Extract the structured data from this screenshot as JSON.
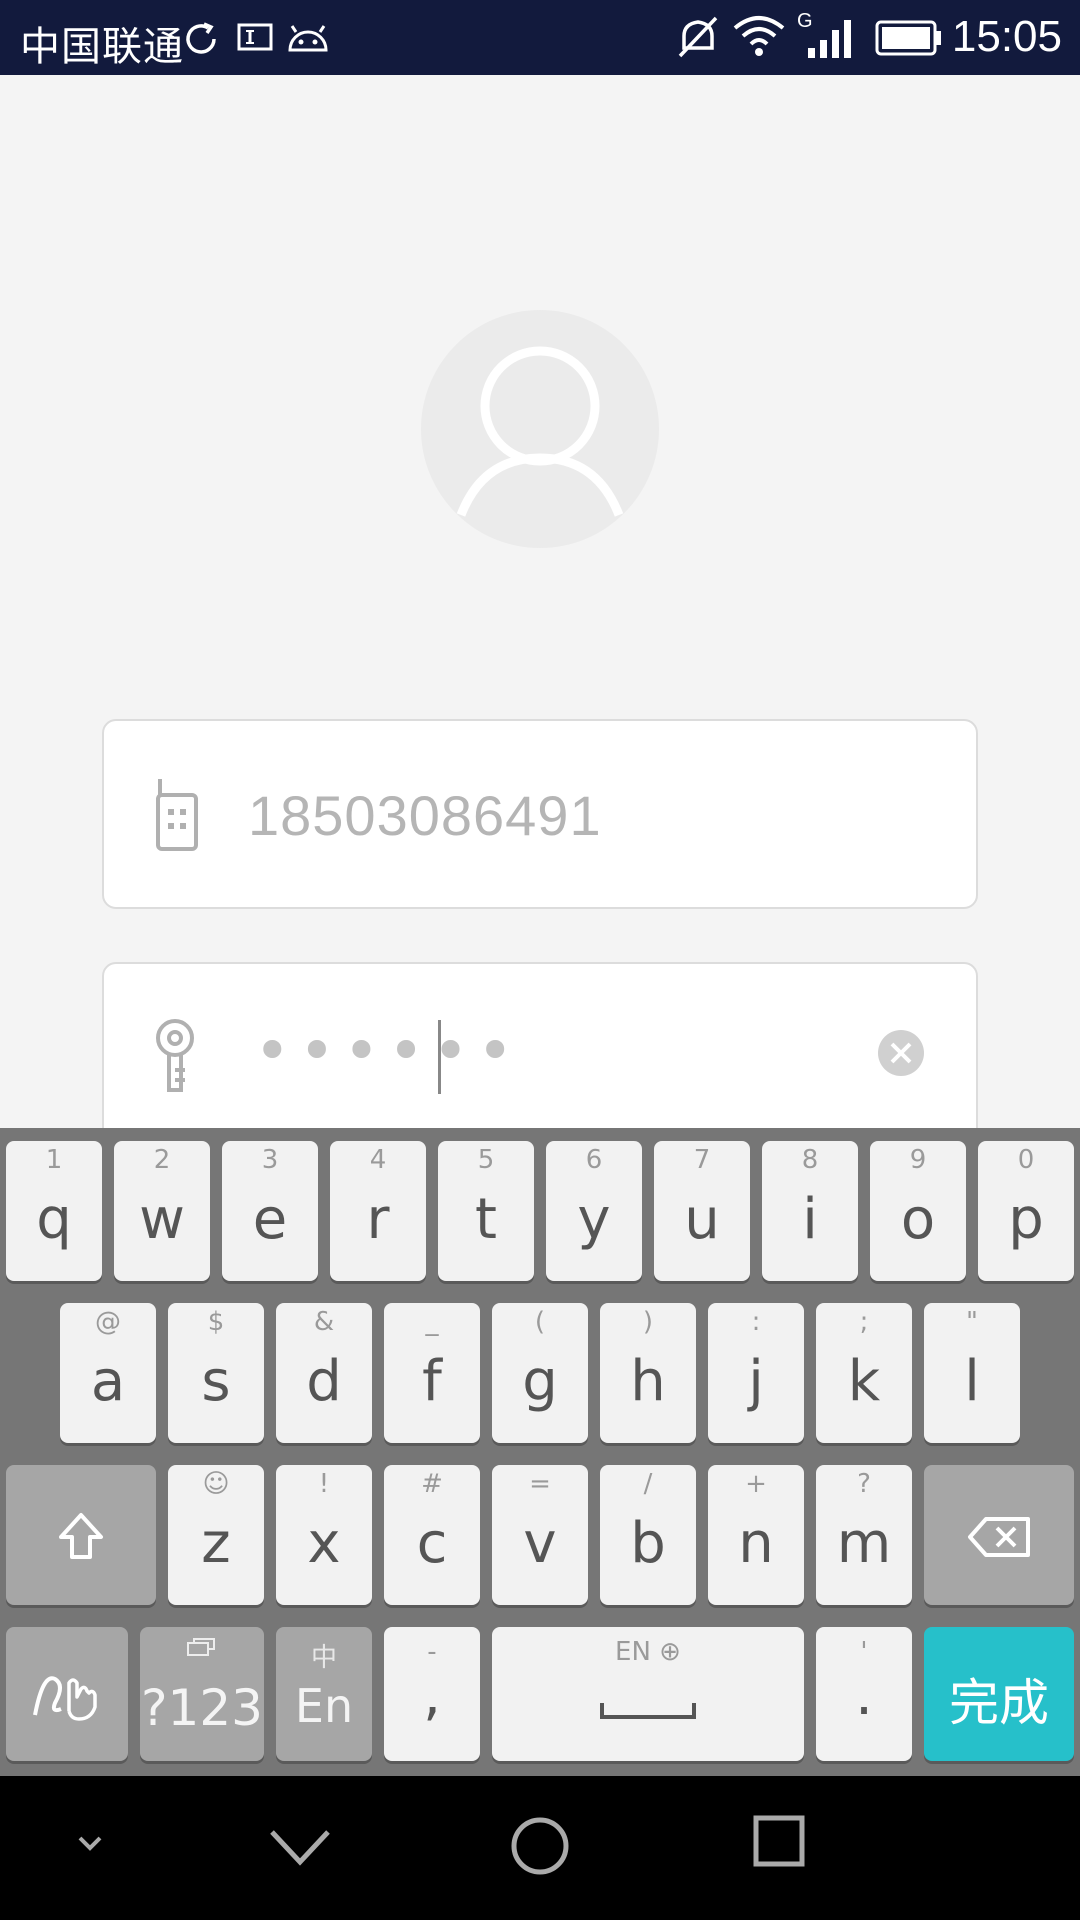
{
  "status_bar": {
    "carrier": "中国联通",
    "time": "15:05",
    "network_type": "G",
    "icons": [
      "sync-icon",
      "sim-card-icon",
      "android-icon",
      "mute-icon",
      "wifi-icon",
      "signal-icon",
      "battery-icon"
    ]
  },
  "login": {
    "phone_value": "18503086491",
    "password_masked": "••••••",
    "icons": [
      "avatar-icon",
      "phone-icon",
      "key-icon",
      "clear-icon"
    ]
  },
  "keyboard": {
    "row1": [
      {
        "hint": "1",
        "label": "q"
      },
      {
        "hint": "2",
        "label": "w"
      },
      {
        "hint": "3",
        "label": "e"
      },
      {
        "hint": "4",
        "label": "r"
      },
      {
        "hint": "5",
        "label": "t"
      },
      {
        "hint": "6",
        "label": "y"
      },
      {
        "hint": "7",
        "label": "u"
      },
      {
        "hint": "8",
        "label": "i"
      },
      {
        "hint": "9",
        "label": "o"
      },
      {
        "hint": "0",
        "label": "p"
      }
    ],
    "row2": [
      {
        "hint": "@",
        "label": "a"
      },
      {
        "hint": "$",
        "label": "s"
      },
      {
        "hint": "&",
        "label": "d"
      },
      {
        "hint": "_",
        "label": "f"
      },
      {
        "hint": "(",
        "label": "g"
      },
      {
        "hint": ")",
        "label": "h"
      },
      {
        "hint": ":",
        "label": "j"
      },
      {
        "hint": ";",
        "label": "k"
      },
      {
        "hint": "\"",
        "label": "l"
      }
    ],
    "row3": [
      {
        "hint": "☺",
        "label": "z"
      },
      {
        "hint": "!",
        "label": "x"
      },
      {
        "hint": "#",
        "label": "c"
      },
      {
        "hint": "=",
        "label": "v"
      },
      {
        "hint": "/",
        "label": "b"
      },
      {
        "hint": "+",
        "label": "n"
      },
      {
        "hint": "?",
        "label": "m"
      }
    ],
    "symbols_label": "?123",
    "lang_hint": "中",
    "lang_label": "En",
    "comma_hint": "-",
    "comma_label": ",",
    "space_hint": "EN ⊕",
    "period_hint": "'",
    "period_label": ".",
    "done_label": "完成",
    "accent_color": "#26c0ca"
  },
  "nav_bar": {
    "icons": [
      "hide-keyboard-icon",
      "back-icon",
      "home-icon",
      "recents-icon"
    ]
  }
}
